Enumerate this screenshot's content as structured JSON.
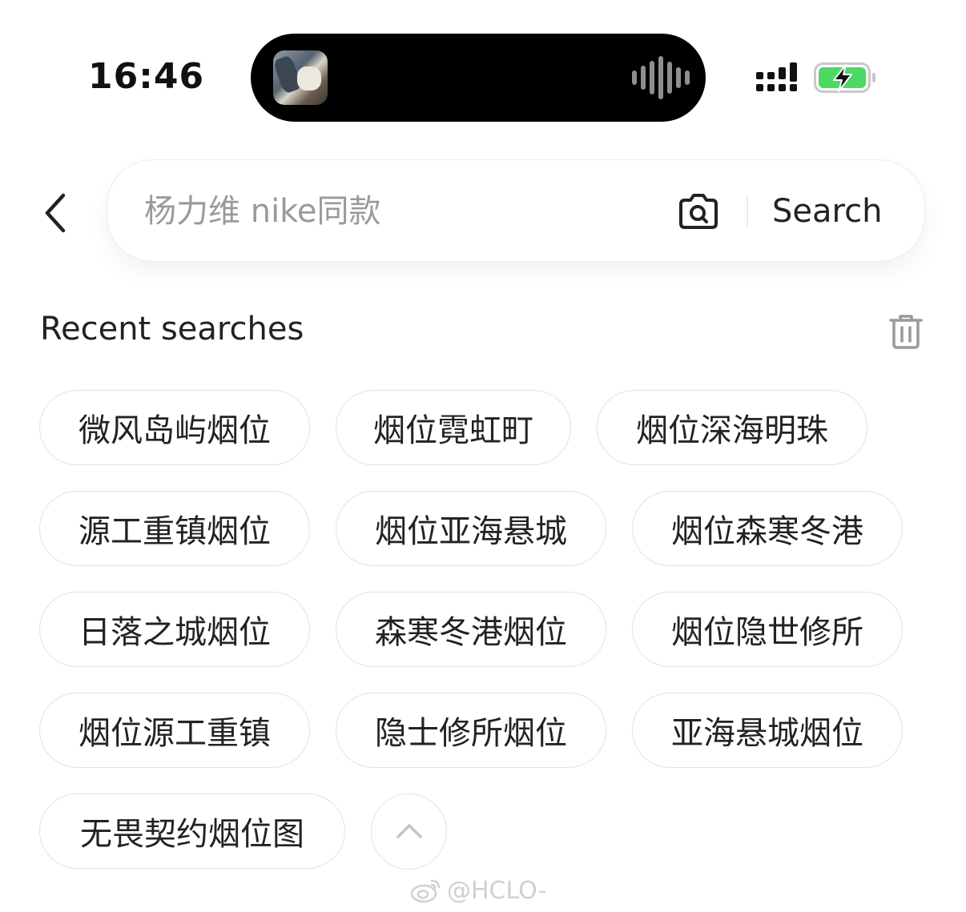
{
  "status_bar": {
    "time": "16:46"
  },
  "search": {
    "placeholder": "杨力维 nike同款",
    "button_label": "Search"
  },
  "recent": {
    "title": "Recent searches",
    "items": [
      "微风岛屿烟位",
      "烟位霓虹町",
      "烟位深海明珠",
      "源工重镇烟位",
      "烟位亚海悬城",
      "烟位森寒冬港",
      "日落之城烟位",
      "森寒冬港烟位",
      "烟位隐世修所",
      "烟位源工重镇",
      "隐士修所烟位",
      "亚海悬城烟位",
      "无畏契约烟位图"
    ]
  },
  "watermark": "@HCLO-",
  "colors": {
    "island": "#000000",
    "battery_fill": "#4cd964",
    "chip_border": "#e3e3e3",
    "placeholder": "#9a9a9a"
  },
  "icons": [
    "back-arrow-icon",
    "camera-icon",
    "trash-icon",
    "chevron-up-icon",
    "signal-icon",
    "battery-charging-icon",
    "weibo-icon"
  ]
}
